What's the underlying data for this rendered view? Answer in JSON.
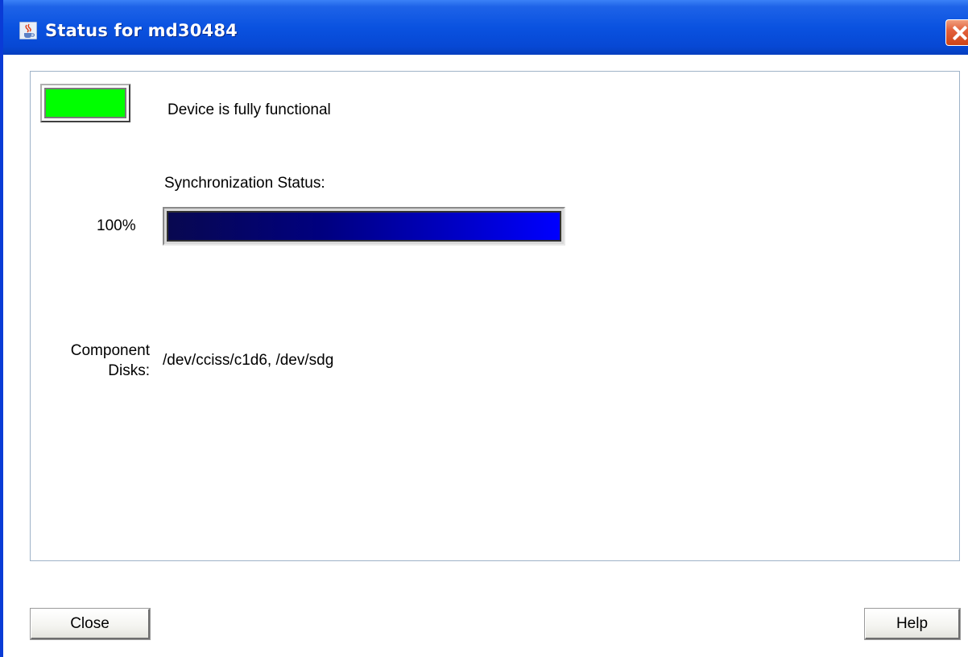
{
  "window": {
    "title": "Status for md30484",
    "app_icon": "java-cup-icon",
    "close_icon": "close-icon"
  },
  "status": {
    "lamp_color": "#00ff00",
    "text": "Device is fully functional"
  },
  "sync": {
    "title": "Synchronization Status:",
    "percent_label": "100%",
    "progress_fraction": 1.0
  },
  "components": {
    "label": "Component Disks:",
    "value": "/dev/cciss/c1d6, /dev/sdg"
  },
  "buttons": {
    "close_label": "Close",
    "help_label": "Help"
  },
  "colors": {
    "titlebar": "#0a52e0",
    "progress_start": "#080850",
    "progress_end": "#0000ff"
  }
}
